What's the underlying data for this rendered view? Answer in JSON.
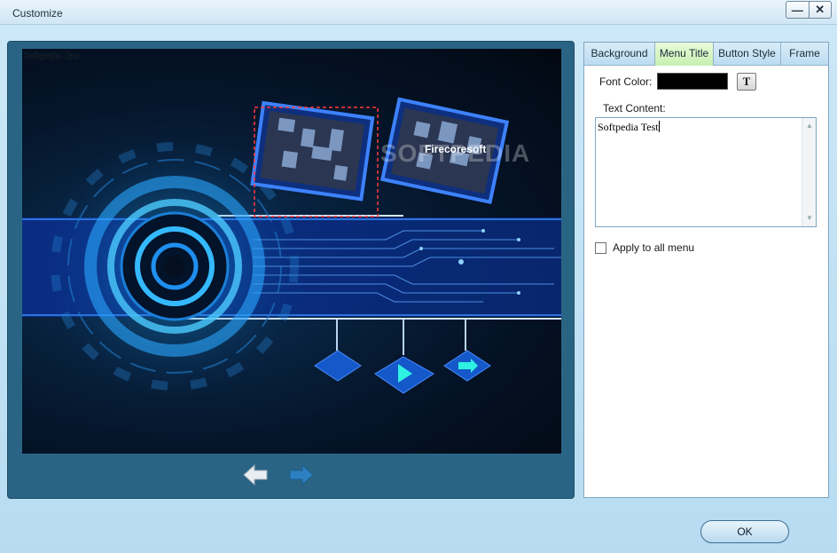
{
  "window": {
    "title": "Customize",
    "minimize_label": "—",
    "close_label": "✕"
  },
  "preview": {
    "menu_title": "Softpedia Test",
    "watermark_brand": "Firecoresoft",
    "watermark_text": "SOFTPEDIA",
    "prev_icon": "arrow-left-icon",
    "next_icon": "arrow-right-icon"
  },
  "tabs": [
    {
      "label": "Background"
    },
    {
      "label": "Menu Title"
    },
    {
      "label": "Button Style"
    },
    {
      "label": "Frame"
    }
  ],
  "active_tab": "Menu Title",
  "menu_title_tab": {
    "font_color_label": "Font Color:",
    "font_color_value": "#000000",
    "font_button_label": "T",
    "text_content_label": "Text Content:",
    "text_content_value": "Softpedia Test",
    "apply_all_label": "Apply to all menu",
    "apply_all_checked": false
  },
  "footer": {
    "ok_label": "OK"
  }
}
